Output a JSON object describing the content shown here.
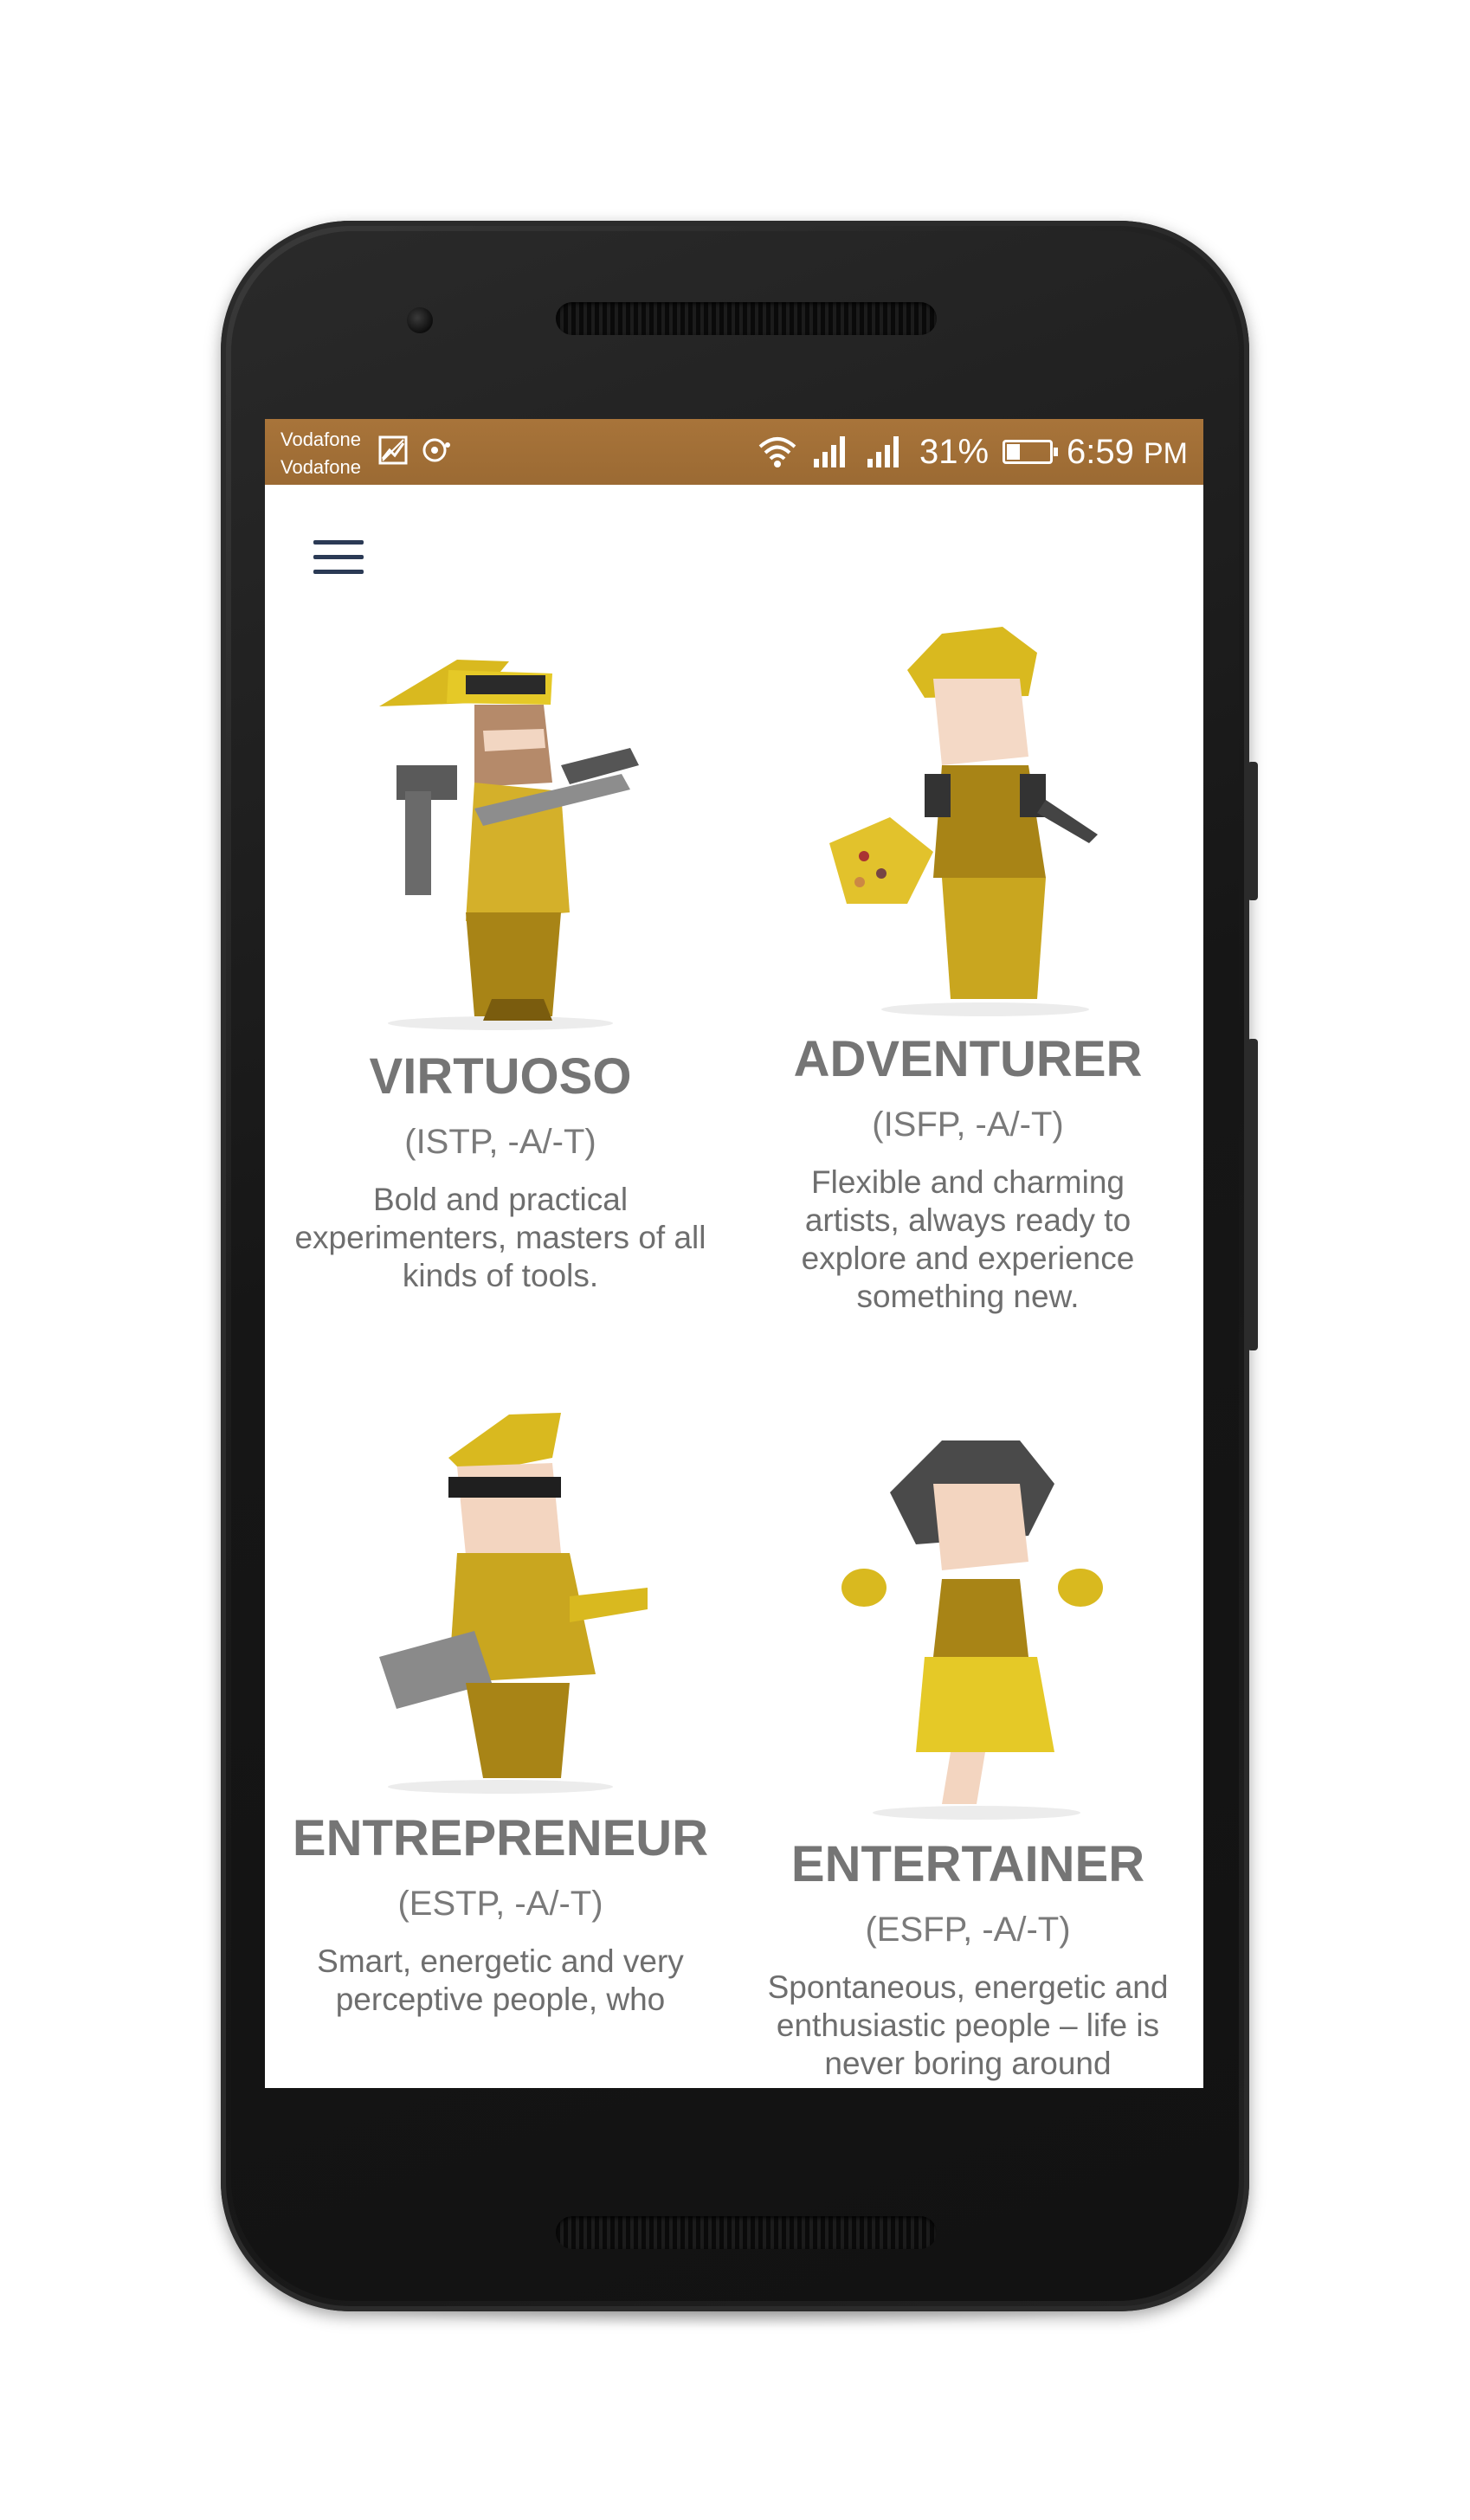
{
  "status_bar": {
    "carrier_1": "Vodafone",
    "carrier_2": "Vodafone",
    "battery_percent": "31%",
    "battery_level": 0.31,
    "time": "6:59",
    "ampm": "PM",
    "icons": [
      "gallery-icon",
      "notification-icon",
      "wifi-icon",
      "signal-icon",
      "signal-icon",
      "battery-icon"
    ]
  },
  "menu": {
    "icon": "hamburger-menu-icon"
  },
  "personalities": [
    {
      "name": "VIRTUOSO",
      "code": "(ISTP, -A/-T)",
      "description": "Bold and practical experimenters, masters of all kinds of tools."
    },
    {
      "name": "ADVENTURER",
      "code": "(ISFP, -A/-T)",
      "description": "Flexible and charming artists, always ready to explore and experience something new."
    },
    {
      "name": "ENTREPRENEUR",
      "code": "(ESTP, -A/-T)",
      "description": "Smart, energetic and very perceptive people, who"
    },
    {
      "name": "ENTERTAINER",
      "code": "(ESFP, -A/-T)",
      "description": "Spontaneous, energetic and enthusiastic people – life is never boring around"
    }
  ],
  "colors": {
    "status_bar": "#a8743a",
    "accent_gold": "#d9b91f",
    "text_gray": "#757575",
    "menu_icon": "#2b3a55"
  }
}
